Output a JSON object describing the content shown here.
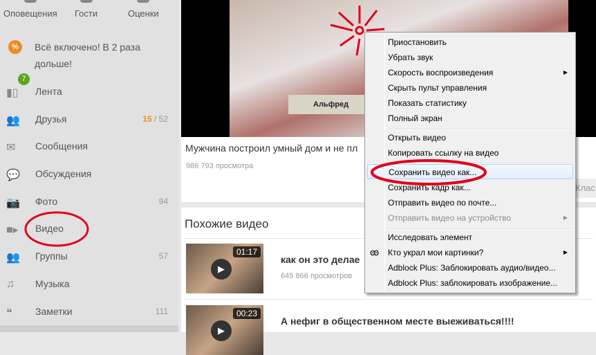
{
  "sidebar": {
    "top": [
      {
        "label": "Оповещения"
      },
      {
        "label": "Гости"
      },
      {
        "label": "Оценки"
      }
    ],
    "promo": "Всё включено! В 2 раза дольше!",
    "items": [
      {
        "label": "Лента",
        "badge": "7"
      },
      {
        "label": "Друзья",
        "count_new": "15",
        "count_sep": " / ",
        "count": "52"
      },
      {
        "label": "Сообщения"
      },
      {
        "label": "Обсуждения"
      },
      {
        "label": "Фото",
        "count": "94"
      },
      {
        "label": "Видео"
      },
      {
        "label": "Группы",
        "count": "57"
      },
      {
        "label": "Музыка"
      },
      {
        "label": "Заметки",
        "count": "111"
      }
    ]
  },
  "video": {
    "caption": "Альфред",
    "title": "Мужчина построил умный дом и не пл",
    "views": "986 793 просмотра",
    "klass": "Клас"
  },
  "similar": {
    "title": "Похожие видео",
    "items": [
      {
        "duration": "01:17",
        "title": "как он это делае",
        "views": "645 866 просмотров"
      },
      {
        "duration": "00:23",
        "title": "А нефиг в общественном месте выеживаться!!!!"
      }
    ]
  },
  "context_menu": {
    "items": [
      "Приостановить",
      "Убрать звук",
      "Скорость воспроизведения",
      "Скрыть пульт управления",
      "Показать статистику",
      "Полный экран",
      "Открыть видео",
      "Копировать ссылку на видео",
      "Сохранить видео как...",
      "Сохранить кадр как...",
      "Отправить видео по почте...",
      "Отправить видео на устройство",
      "Исследовать элемент",
      "Кто украл мои картинки?",
      "Adblock Plus: Заблокировать аудио/видео...",
      "Adblock Plus: заблокировать изображение..."
    ]
  },
  "colors": {
    "accent": "#f08a24",
    "badge": "#5aa51a",
    "annotation": "#e0001a"
  }
}
